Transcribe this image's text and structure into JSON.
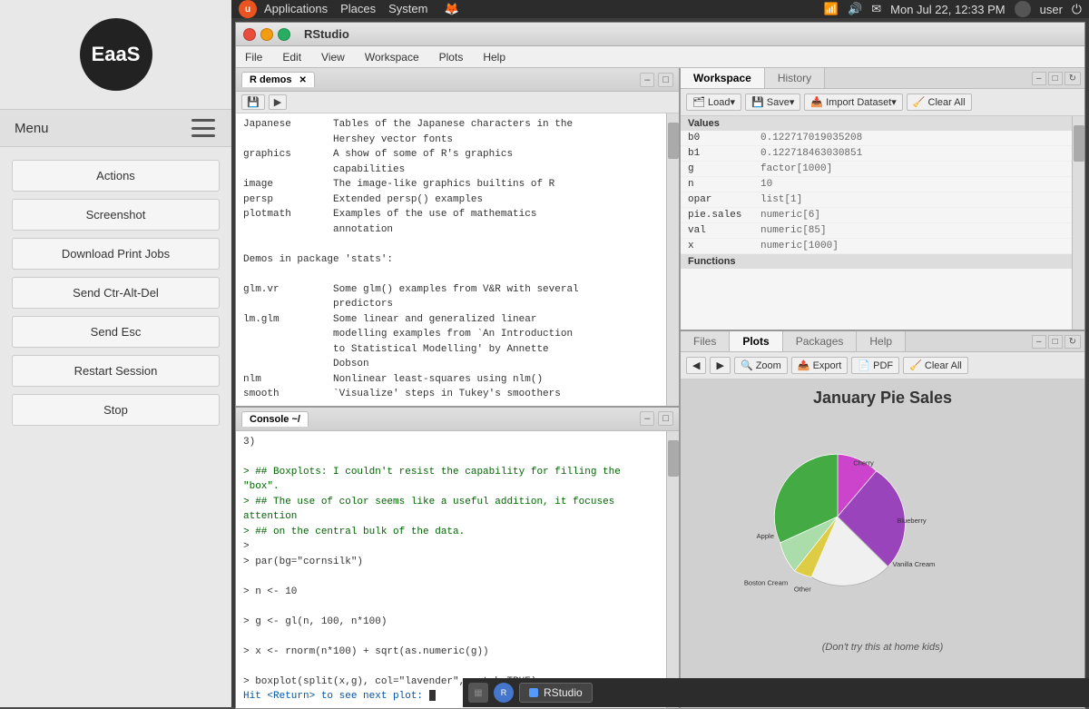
{
  "app": {
    "logo": "EaaS",
    "menu_label": "Menu"
  },
  "sidebar": {
    "buttons": [
      {
        "id": "actions",
        "label": "Actions"
      },
      {
        "id": "screenshot",
        "label": "Screenshot"
      },
      {
        "id": "download-print",
        "label": "Download Print Jobs"
      },
      {
        "id": "send-ctrl-alt-del",
        "label": "Send Ctr-Alt-Del"
      },
      {
        "id": "send-esc",
        "label": "Send Esc"
      },
      {
        "id": "restart-session",
        "label": "Restart Session"
      },
      {
        "id": "stop",
        "label": "Stop"
      }
    ]
  },
  "topbar": {
    "ubuntu_label": "u",
    "nav_items": [
      "Applications",
      "Places",
      "System"
    ],
    "datetime": "Mon Jul 22, 12:33 PM",
    "user": "user"
  },
  "rstudio": {
    "title": "RStudio",
    "menu": [
      "File",
      "Edit",
      "View",
      "Workspace",
      "Plots",
      "Help"
    ],
    "editor": {
      "tab": "R demos",
      "content": [
        "Japanese       Tables of the Japanese characters in the",
        "               Hershey vector fonts",
        "graphics       A show of some of R's graphics",
        "               capabilities",
        "image          The image-like graphics builtins of R",
        "persp          Extended persp() examples",
        "plotmath       Examples of the use of mathematics",
        "               annotation",
        "",
        "Demos in package 'stats':",
        "",
        "glm.vr         Some glm() examples from V&R with several",
        "               predictors",
        "lm.glm         Some linear and generalized linear",
        "               modelling examples from `An Introduction",
        "               to Statistical Modelling' by Annette",
        "               Dobson",
        "nlm            Nonlinear least-squares using nlm()",
        "smooth         `Visualize' steps in Tukey's smoothers"
      ]
    },
    "console": {
      "tab": "Console ~/",
      "content": [
        {
          "type": "output",
          "text": "3)"
        },
        {
          "type": "blank",
          "text": ""
        },
        {
          "type": "comment",
          "text": "> ## Boxplots:  I couldn't resist the capability for filling the \"box\"."
        },
        {
          "type": "comment",
          "text": "> ## The use of color seems like a useful addition, it focuses attention"
        },
        {
          "type": "comment",
          "text": "> ## on the central bulk of the data."
        },
        {
          "type": "prompt",
          "text": ">"
        },
        {
          "type": "code",
          "text": "> par(bg=\"cornsilk\")"
        },
        {
          "type": "blank",
          "text": ""
        },
        {
          "type": "code",
          "text": "> n <- 10"
        },
        {
          "type": "blank",
          "text": ""
        },
        {
          "type": "code",
          "text": "> g <- gl(n, 100, n*100)"
        },
        {
          "type": "blank",
          "text": ""
        },
        {
          "type": "code",
          "text": "> x <- rnorm(n*100) + sqrt(as.numeric(g))"
        },
        {
          "type": "blank",
          "text": ""
        },
        {
          "type": "code",
          "text": "> boxplot(split(x,g), col=\"lavender\", notch=TRUE)"
        },
        {
          "type": "input",
          "text": "Hit <Return> to see next plot: "
        }
      ]
    },
    "workspace": {
      "tabs": [
        "Workspace",
        "History"
      ],
      "active_tab": "Workspace",
      "toolbar_btns": [
        "Load▾",
        "Save▾",
        "Import Dataset▾",
        "Clear All"
      ],
      "sections": [
        {
          "name": "Values",
          "rows": [
            {
              "name": "b0",
              "value": "0.122717019035208"
            },
            {
              "name": "b1",
              "value": "0.122718463030851"
            },
            {
              "name": "g",
              "value": "factor[1000]"
            },
            {
              "name": "n",
              "value": "10"
            },
            {
              "name": "opar",
              "value": "list[1]"
            },
            {
              "name": "pie.sales",
              "value": "numeric[6]"
            },
            {
              "name": "val",
              "value": "numeric[85]"
            },
            {
              "name": "x",
              "value": "numeric[1000]"
            }
          ]
        },
        {
          "name": "Functions",
          "rows": []
        }
      ]
    },
    "files": {
      "tabs": [
        "Files",
        "Plots",
        "Packages",
        "Help"
      ],
      "active_tab": "Plots",
      "toolbar_btns": [
        "◀",
        "▶",
        "Zoom",
        "Export",
        "PDF",
        "Clear All"
      ],
      "plot": {
        "title": "January Pie Sales",
        "disclaimer": "(Don't try this at home kids)",
        "slices": [
          {
            "label": "Cherry",
            "color": "#cc44cc",
            "percent": 12,
            "start_angle": 0,
            "end_angle": 43
          },
          {
            "label": "Blueberry",
            "color": "#cc44cc",
            "percent": 30,
            "start_angle": 43,
            "end_angle": 151
          },
          {
            "label": "Vanilla Cream",
            "color": "#ffffff",
            "percent": 26,
            "start_angle": 151,
            "end_angle": 245
          },
          {
            "label": "Other",
            "color": "#ffcc44",
            "percent": 8,
            "start_angle": 245,
            "end_angle": 274
          },
          {
            "label": "Boston Cream",
            "color": "#aaddaa",
            "percent": 10,
            "start_angle": 274,
            "end_angle": 310
          },
          {
            "label": "Apple",
            "color": "#44aa44",
            "percent": 14,
            "start_angle": 310,
            "end_angle": 360
          }
        ]
      }
    }
  },
  "taskbar": {
    "rstudio_label": "RStudio"
  }
}
